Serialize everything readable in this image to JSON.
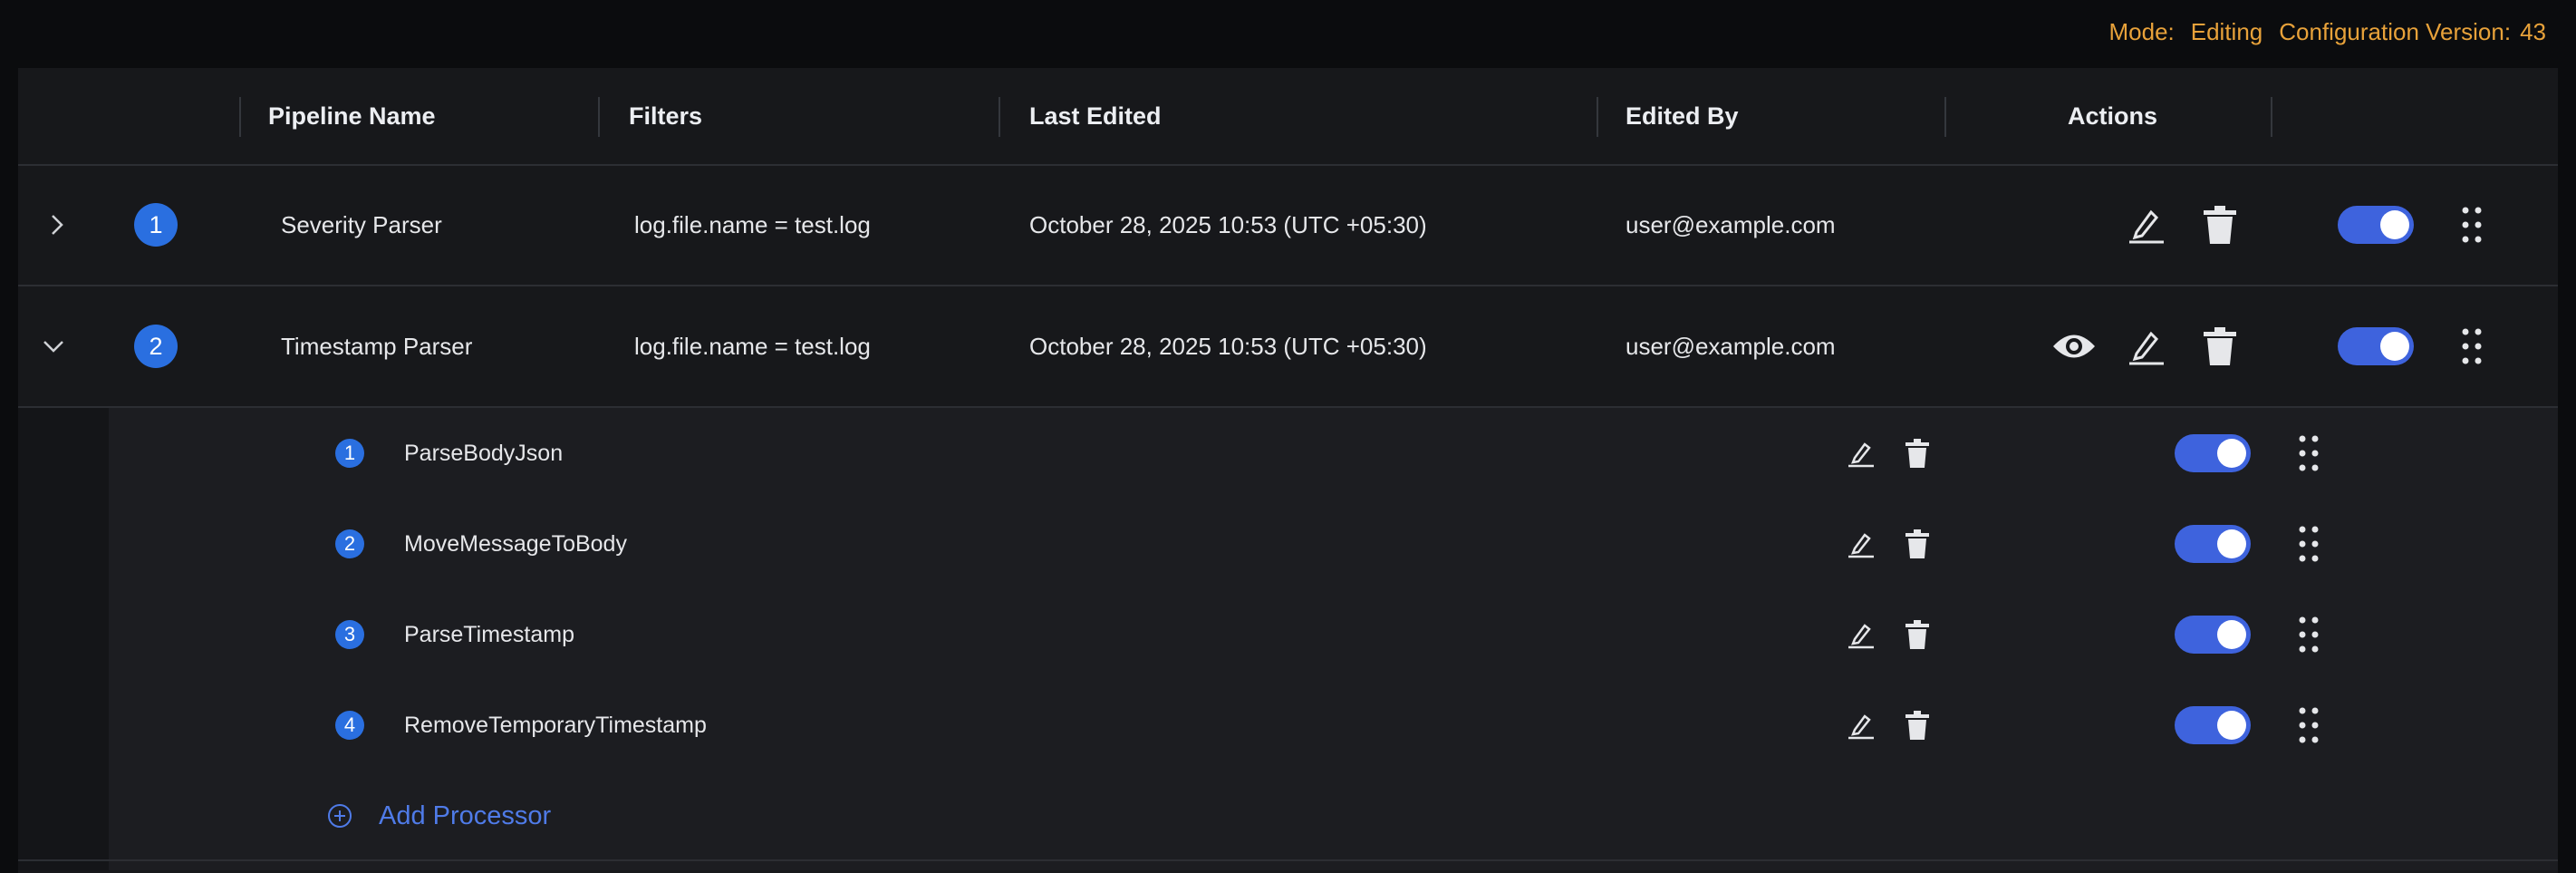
{
  "mode": {
    "label": "Mode:",
    "value": "Editing"
  },
  "config": {
    "label": "Configuration Version:",
    "value": "43"
  },
  "columns": {
    "pipeline_name": "Pipeline Name",
    "filters": "Filters",
    "last_edited": "Last Edited",
    "edited_by": "Edited By",
    "actions": "Actions"
  },
  "pipelines": [
    {
      "index": "1",
      "name": "Severity Parser",
      "filter": "log.file.name = test.log",
      "last_edited": "October 28, 2025 10:53 (UTC +05:30)",
      "edited_by": "user@example.com",
      "expanded": false,
      "enabled": true
    },
    {
      "index": "2",
      "name": "Timestamp Parser",
      "filter": "log.file.name = test.log",
      "last_edited": "October 28, 2025 10:53 (UTC +05:30)",
      "edited_by": "user@example.com",
      "expanded": true,
      "enabled": true
    }
  ],
  "processors": [
    {
      "index": "1",
      "name": "ParseBodyJson",
      "enabled": true
    },
    {
      "index": "2",
      "name": "MoveMessageToBody",
      "enabled": true
    },
    {
      "index": "3",
      "name": "ParseTimestamp",
      "enabled": true
    },
    {
      "index": "4",
      "name": "RemoveTemporaryTimestamp",
      "enabled": true
    }
  ],
  "add_processor_label": "Add Processor",
  "colors": {
    "accent": "#3e63dd",
    "badge": "#2a6fe0",
    "mode": "#e8a23a",
    "link": "#4f7be8"
  }
}
